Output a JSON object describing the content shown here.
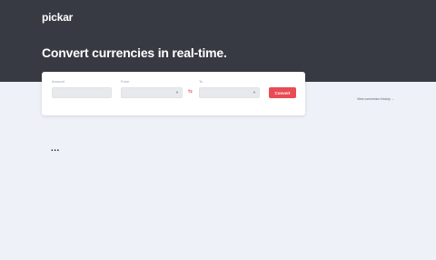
{
  "header": {
    "logo": "pickar",
    "headline": "Convert currencies in real-time."
  },
  "form": {
    "amount_label": "Amount",
    "amount_value": "",
    "from_label": "From",
    "from_value": "",
    "to_label": "To",
    "to_value": "",
    "swap_icon": "swap-arrows-icon",
    "convert_label": "Convert"
  },
  "history_link": "View conversion history →",
  "loading_text": "...",
  "colors": {
    "header_bg": "#373a43",
    "page_bg": "#eef1f7",
    "accent": "#e94b55"
  }
}
